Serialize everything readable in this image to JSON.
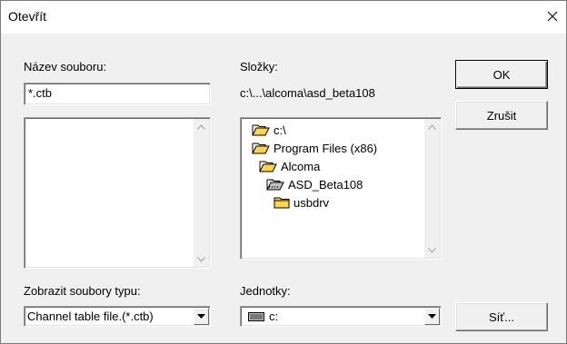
{
  "window": {
    "title": "Otevřít",
    "close_icon": "close-icon"
  },
  "filename": {
    "label": "Název souboru:",
    "value": "*.ctb"
  },
  "folders": {
    "label": "Složky:",
    "current_path": "c:\\...\\alcoma\\asd_beta108",
    "items": [
      {
        "name": "c:\\",
        "icon": "open-folder-icon"
      },
      {
        "name": "Program Files (x86)",
        "icon": "open-folder-icon"
      },
      {
        "name": "Alcoma",
        "icon": "open-folder-icon"
      },
      {
        "name": "ASD_Beta108",
        "icon": "open-folder-selected-icon"
      },
      {
        "name": "usbdrv",
        "icon": "closed-folder-icon"
      }
    ]
  },
  "buttons": {
    "ok": "OK",
    "cancel": "Zrušit",
    "network": "Síť..."
  },
  "file_type": {
    "label": "Zobrazit soubory typu:",
    "selected": "Channel table file.(*.ctb)"
  },
  "drives": {
    "label": "Jednotky:",
    "selected": "c:"
  },
  "colors": {
    "folder_yellow": "#ffd34e",
    "folder_outline": "#000000",
    "window_bg": "#f0f0f0"
  }
}
